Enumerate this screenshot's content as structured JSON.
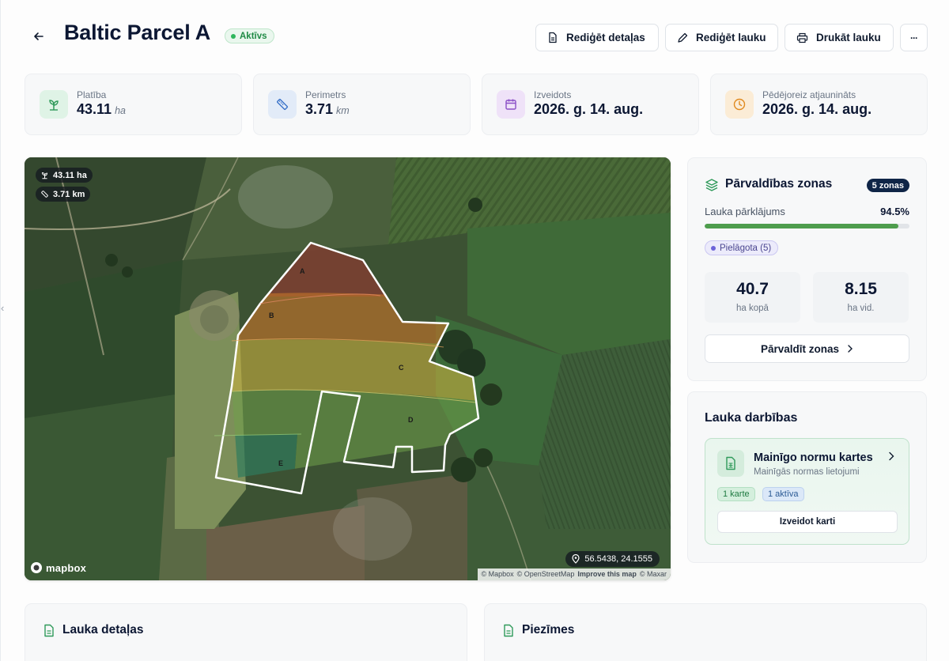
{
  "header": {
    "title": "Baltic Parcel A",
    "status": "Aktīvs",
    "buttons": {
      "edit_details": "Rediģēt detaļas",
      "edit_field": "Rediģēt lauku",
      "print_field": "Drukāt lauku",
      "more": "···"
    }
  },
  "stats": [
    {
      "label": "Platība",
      "value": "43.11",
      "unit": "ha",
      "icon": "plant-icon",
      "color": "#2f9a5a"
    },
    {
      "label": "Perimetrs",
      "value": "3.71",
      "unit": "km",
      "icon": "ruler-icon",
      "color": "#3b73c9"
    },
    {
      "label": "Izveidots",
      "value": "2026. g. 14. aug.",
      "unit": "",
      "icon": "calendar-icon",
      "color": "#8b4fc6"
    },
    {
      "label": "Pēdējoreiz atjaunināts",
      "value": "2026. g. 14. aug.",
      "unit": "",
      "icon": "clock-icon",
      "color": "#e08a1f"
    }
  ],
  "map": {
    "area_chip": "43.11 ha",
    "perimeter_chip": "3.71 km",
    "coordinates": "56.5438, 24.1555",
    "logo": "mapbox",
    "attribution": {
      "mapbox": "© Mapbox",
      "osm": "© OpenStreetMap",
      "improve": "Improve this map",
      "maxar": "© Maxar"
    },
    "zones": [
      {
        "label": "A",
        "color": "#8b3a30"
      },
      {
        "label": "B",
        "color": "#c0722a"
      },
      {
        "label": "C",
        "color": "#c8b040"
      },
      {
        "label": "D",
        "color": "#6fa04a"
      },
      {
        "label": "E",
        "color": "#2f7a5c"
      }
    ]
  },
  "zones_panel": {
    "title": "Pārvaldības zonas",
    "count": "5 zonas",
    "coverage_label": "Lauka pārklājums",
    "coverage_value": "94.5%",
    "coverage_fraction": 0.945,
    "adjusted_chip": "Pielāgota (5)",
    "total_value": "40.7",
    "total_label": "ha kopā",
    "avg_value": "8.15",
    "avg_label": "ha vid.",
    "manage_button": "Pārvaldīt zonas"
  },
  "actions_panel": {
    "title": "Lauka darbības",
    "card_title": "Mainīgo normu kartes",
    "card_subtitle": "Mainīgās normas lietojumi",
    "chip_maps": "1 karte",
    "chip_active": "1 aktīva",
    "create_button": "Izveidot karti"
  },
  "bottom": {
    "details_title": "Lauka detaļas",
    "notes_title": "Piezīmes"
  }
}
